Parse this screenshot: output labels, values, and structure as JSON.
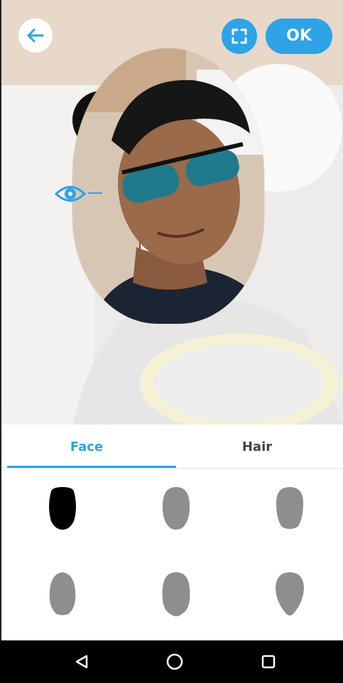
{
  "header": {
    "back_icon": "arrow-left-icon",
    "expand_icon": "expand-frame-icon",
    "ok_label": "OK"
  },
  "editor": {
    "eye_icon": "eye-icon"
  },
  "tabs": [
    {
      "label": "Face",
      "active": true
    },
    {
      "label": "Hair",
      "active": false
    }
  ],
  "face_shapes": [
    {
      "name": "shape-1",
      "selected": true
    },
    {
      "name": "shape-2",
      "selected": false
    },
    {
      "name": "shape-3",
      "selected": false
    },
    {
      "name": "shape-4",
      "selected": false
    },
    {
      "name": "shape-5",
      "selected": false
    },
    {
      "name": "shape-6",
      "selected": false
    }
  ],
  "nav": {
    "back_icon": "triangle-back-icon",
    "home_icon": "circle-home-icon",
    "recents_icon": "square-recents-icon"
  },
  "colors": {
    "accent": "#2ea3e8",
    "shape_selected": "#000000",
    "shape_default": "#8e8e8e"
  }
}
